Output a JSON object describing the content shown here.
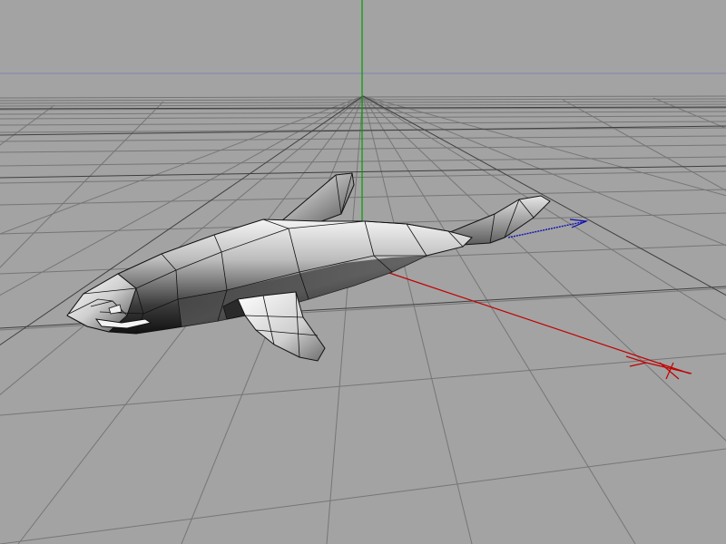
{
  "viewport": {
    "view": "perspective",
    "background_color": "#a3a3a3",
    "grid_color": "#767676",
    "grid_major_color": "#3f3f3f",
    "horizon_color": "#8080b8",
    "axis_colors": {
      "x": "#c00000",
      "y": "#00a000",
      "z": "#1010b0"
    },
    "grid": true
  },
  "model": {
    "object": "shark",
    "shading": "gouraud-with-wireframe"
  }
}
